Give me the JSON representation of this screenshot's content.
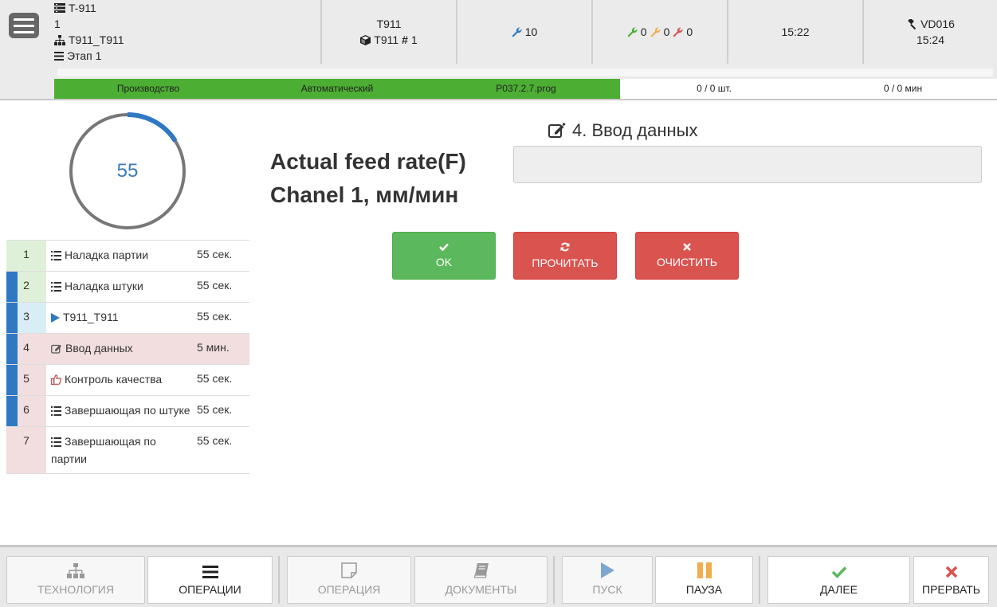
{
  "header": {
    "machine_code": "T-911",
    "line2": "1",
    "structure_name": "T911_T911",
    "stage": "Этап 1",
    "cells": {
      "part_name": "T911",
      "part_code": "T911",
      "part_number": "1",
      "tool_count": "10",
      "tool_ok": "0",
      "tool_warn": "0",
      "tool_bad": "0",
      "time_1": "15:22",
      "operator_id": "VD016",
      "operator_time": "15:24"
    },
    "status": {
      "mode": "Производство",
      "auto": "Автоматический",
      "program": "P037.2.7.prog",
      "pieces": "0 / 0 шт.",
      "minutes": "0 / 0 мин"
    }
  },
  "timer": {
    "value": "55",
    "progress": 0.16,
    "colors": {
      "arc": "#2f78c2",
      "ring": "#777777"
    }
  },
  "operations": [
    {
      "num": "1",
      "icon": "list-icon",
      "name": "Наладка партии",
      "time": "55 сек.",
      "state": "done"
    },
    {
      "num": "2",
      "icon": "list-icon",
      "name": "Наладка штуки",
      "time": "55 сек.",
      "state": "done"
    },
    {
      "num": "3",
      "icon": "play-icon",
      "name": "T911_T911",
      "time": "55 сек.",
      "state": "current"
    },
    {
      "num": "4",
      "icon": "edit-icon",
      "name": "Ввод данных",
      "time": "5 мин.",
      "state": "active"
    },
    {
      "num": "5",
      "icon": "thumbs-up-icon",
      "name": "Контроль качества",
      "time": "55 сек.",
      "state": "pending"
    },
    {
      "num": "6",
      "icon": "list-icon",
      "name": "Завершающая по штуке",
      "time": "55 сек.",
      "state": "pending"
    },
    {
      "num": "7",
      "icon": "list-icon",
      "name": "Завершающая по партии",
      "time": "55 сек.",
      "state": "pending"
    }
  ],
  "main": {
    "title_line1": "Actual feed rate(F)",
    "title_line2": "Chanel 1, мм/мин",
    "step_title": "4. Ввод данных",
    "input_value": "",
    "buttons": {
      "ok": "OK",
      "read": "ПРОЧИТАТЬ",
      "clear": "ОЧИСТИТЬ"
    }
  },
  "footer": {
    "technology": "ТЕХНОЛОГИЯ",
    "operations": "ОПЕРАЦИИ",
    "operation": "ОПЕРАЦИЯ",
    "documents": "ДОКУМЕНТЫ",
    "start": "ПУСК",
    "pause": "ПАУЗА",
    "next": "ДАЛЕЕ",
    "abort": "ПРЕРВАТЬ"
  },
  "colors": {
    "green": "#4cae33",
    "ok_green": "#5cb85c",
    "red": "#d9534f",
    "blue": "#2f78c2",
    "pause_orange": "#f0ad4e"
  }
}
